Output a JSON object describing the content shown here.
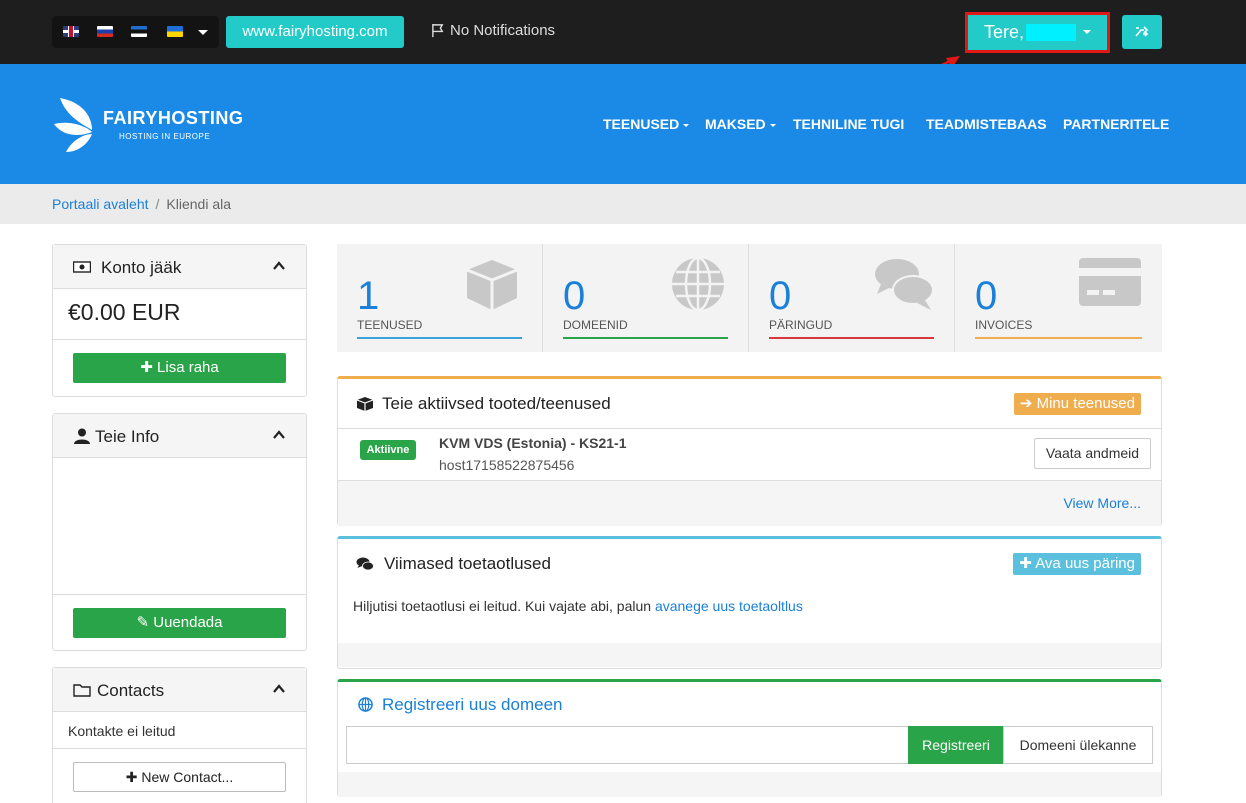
{
  "topbar": {
    "languages": [
      "uk-flag",
      "ru-flag",
      "ee-flag",
      "ua-flag"
    ],
    "site_button": "www.fairyhosting.com",
    "notifications": "No Notifications",
    "greeting": "Tere,"
  },
  "header": {
    "logo_name": "FAIRYHOSTING",
    "logo_tagline": "HOSTING IN EUROPE",
    "nav": [
      "TEENUSED",
      "MAKSED",
      "TEHNILINE TUGI",
      "TEADMISTEBAAS",
      "PARTNERITELE"
    ]
  },
  "breadcrumb": {
    "home": "Portaali avaleht",
    "current": "Kliendi ala"
  },
  "sidebar": {
    "balance": {
      "title": "Konto jääk",
      "amount": "€0.00 EUR",
      "button": "Lisa raha"
    },
    "info": {
      "title": "Teie Info",
      "button": "Uuendada"
    },
    "contacts": {
      "title": "Contacts",
      "empty": "Kontakte ei leitud",
      "button": "New Contact..."
    }
  },
  "stats": [
    {
      "value": "1",
      "label": "TEENUSED",
      "color": "#3aa3d9"
    },
    {
      "value": "0",
      "label": "DOMEENID",
      "color": "#2aa448"
    },
    {
      "value": "0",
      "label": "PÄRINGUD",
      "color": "#d9363e"
    },
    {
      "value": "0",
      "label": "INVOICES",
      "color": "#f0ad4e"
    }
  ],
  "services": {
    "title": "Teie aktiivsed tooted/teenused",
    "button": "Minu teenused",
    "item": {
      "status": "Aktiivne",
      "name": "KVM VDS (Estonia) - KS21-1",
      "host": "host17158522875456",
      "action": "Vaata andmeid"
    },
    "more": "View More..."
  },
  "tickets": {
    "title": "Viimased toetaotlused",
    "button": "Ava uus päring",
    "empty_text": "Hiljutisi toetaotlusi ei leitud. Kui vajate abi, palun",
    "empty_link": "avanege uus toetaoltlus"
  },
  "domain": {
    "title": "Registreeri uus domeen",
    "register": "Registreeri",
    "transfer": "Domeeni ülekanne"
  },
  "colors": {
    "accent": "#22cbc8",
    "brand": "#1a8ae6",
    "success": "#2aa448"
  }
}
